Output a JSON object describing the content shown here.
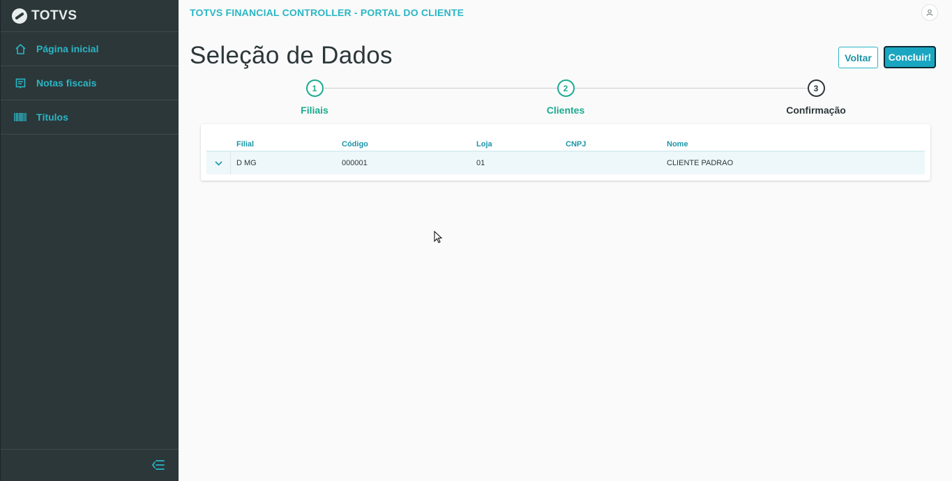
{
  "brand": {
    "name": "TOTVS"
  },
  "sidebar": {
    "items": [
      {
        "label": "Página inicial",
        "icon": "home-icon"
      },
      {
        "label": "Notas fiscais",
        "icon": "receipt-icon"
      },
      {
        "label": "Títulos",
        "icon": "barcode-icon"
      }
    ],
    "collapse_icon": "collapse-menu-icon"
  },
  "header": {
    "app_title": "TOTVS FINANCIAL CONTROLLER - PORTAL DO CLIENTE",
    "user_icon": "user-icon"
  },
  "page": {
    "title": "Seleção de Dados",
    "actions": {
      "back_label": "Voltar",
      "finish_label": "Concluir!"
    }
  },
  "stepper": {
    "steps": [
      {
        "number": "1",
        "label": "Filiais",
        "status": "done"
      },
      {
        "number": "2",
        "label": "Clientes",
        "status": "done"
      },
      {
        "number": "3",
        "label": "Confirmação",
        "status": "current"
      }
    ]
  },
  "table": {
    "columns": [
      "Filial",
      "Código",
      "Loja",
      "CNPJ",
      "Nome"
    ],
    "rows": [
      {
        "filial": "D MG",
        "codigo": "000001",
        "loja": "01",
        "cnpj": "",
        "nome": "CLIENTE PADRAO"
      }
    ]
  },
  "colors": {
    "sidebar_bg": "#2c3739",
    "accent": "#29b6c5",
    "step_done": "#1aab8f",
    "primary_button": "#1aa6c0"
  }
}
